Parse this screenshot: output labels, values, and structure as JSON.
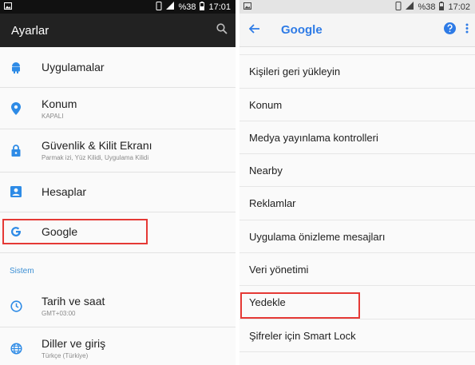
{
  "left": {
    "status": {
      "battery": "%38",
      "time": "17:01"
    },
    "title": "Ayarlar",
    "items": [
      {
        "label": "Uygulamalar"
      },
      {
        "label": "Konum",
        "sub": "KAPALI"
      },
      {
        "label": "Güvenlik & Kilit Ekranı",
        "sub": "Parmak izi, Yüz Kilidi, Uygulama Kilidi"
      },
      {
        "label": "Hesaplar"
      },
      {
        "label": "Google"
      }
    ],
    "section": "Sistem",
    "system_items": [
      {
        "label": "Tarih ve saat",
        "sub": "GMT+03:00"
      },
      {
        "label": "Diller ve giriş",
        "sub": "Türkçe (Türkiye)"
      }
    ]
  },
  "right": {
    "status": {
      "battery": "%38",
      "time": "17:02"
    },
    "title": "Google",
    "items": [
      "Kişileri geri yükleyin",
      "Konum",
      "Medya yayınlama kontrolleri",
      "Nearby",
      "Reklamlar",
      "Uygulama önizleme mesajları",
      "Veri yönetimi",
      "Yedekle",
      "Şifreler için Smart Lock"
    ]
  },
  "colors": {
    "accent_blue": "#2e7be6",
    "highlight_red": "#e53935",
    "dark_toolbar": "#222222"
  }
}
